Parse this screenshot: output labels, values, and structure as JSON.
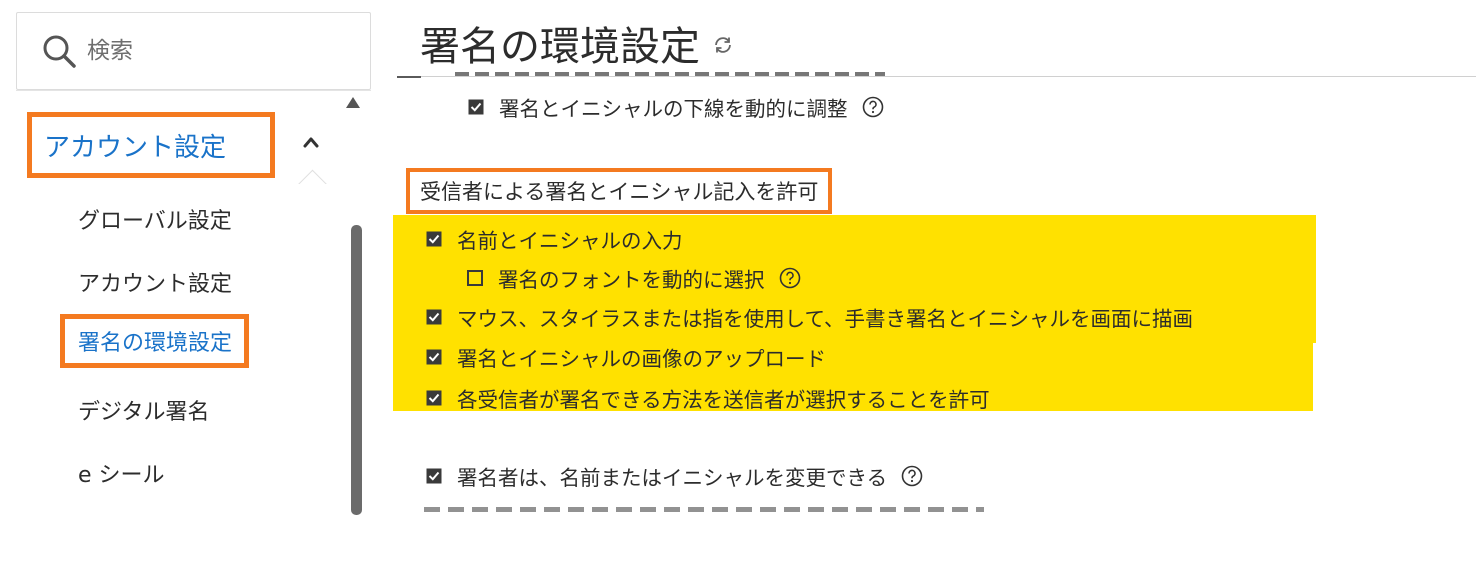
{
  "sidebar": {
    "search_placeholder": "検索",
    "section_label": "アカウント設定",
    "items": [
      {
        "label": "グローバル設定"
      },
      {
        "label": "アカウント設定"
      },
      {
        "label": "署名の環境設定",
        "active": true
      },
      {
        "label": "デジタル署名"
      },
      {
        "label": "e シール"
      }
    ]
  },
  "main": {
    "title": "署名の環境設定",
    "option_dynamic_underline": {
      "label": "署名とイニシャルの下線を動的に調整",
      "checked": true
    },
    "group_heading": "受信者による署名とイニシャル記入を許可",
    "group_options": [
      {
        "label": "名前とイニシャルの入力",
        "checked": true
      },
      {
        "label": "署名のフォントを動的に選択",
        "checked": false
      },
      {
        "label": "マウス、スタイラスまたは指を使用して、手書き署名とイニシャルを画面に描画",
        "checked": true
      },
      {
        "label": "署名とイニシャルの画像のアップロード",
        "checked": true
      },
      {
        "label": "各受信者が署名できる方法を送信者が選択することを許可",
        "checked": true
      }
    ],
    "option_change_name": {
      "label": "署名者は、名前またはイニシャルを変更できる",
      "checked": true
    }
  },
  "colors": {
    "accent_orange": "#f47a20",
    "link_blue": "#1a73c9",
    "highlight_yellow": "#ffe100"
  },
  "icons": {
    "search": "search-icon",
    "chevron": "chevron-up-icon",
    "refresh": "refresh-icon",
    "help": "help-icon",
    "checkbox_checked": "checkbox-checked-icon",
    "checkbox_empty": "checkbox-empty-icon"
  }
}
